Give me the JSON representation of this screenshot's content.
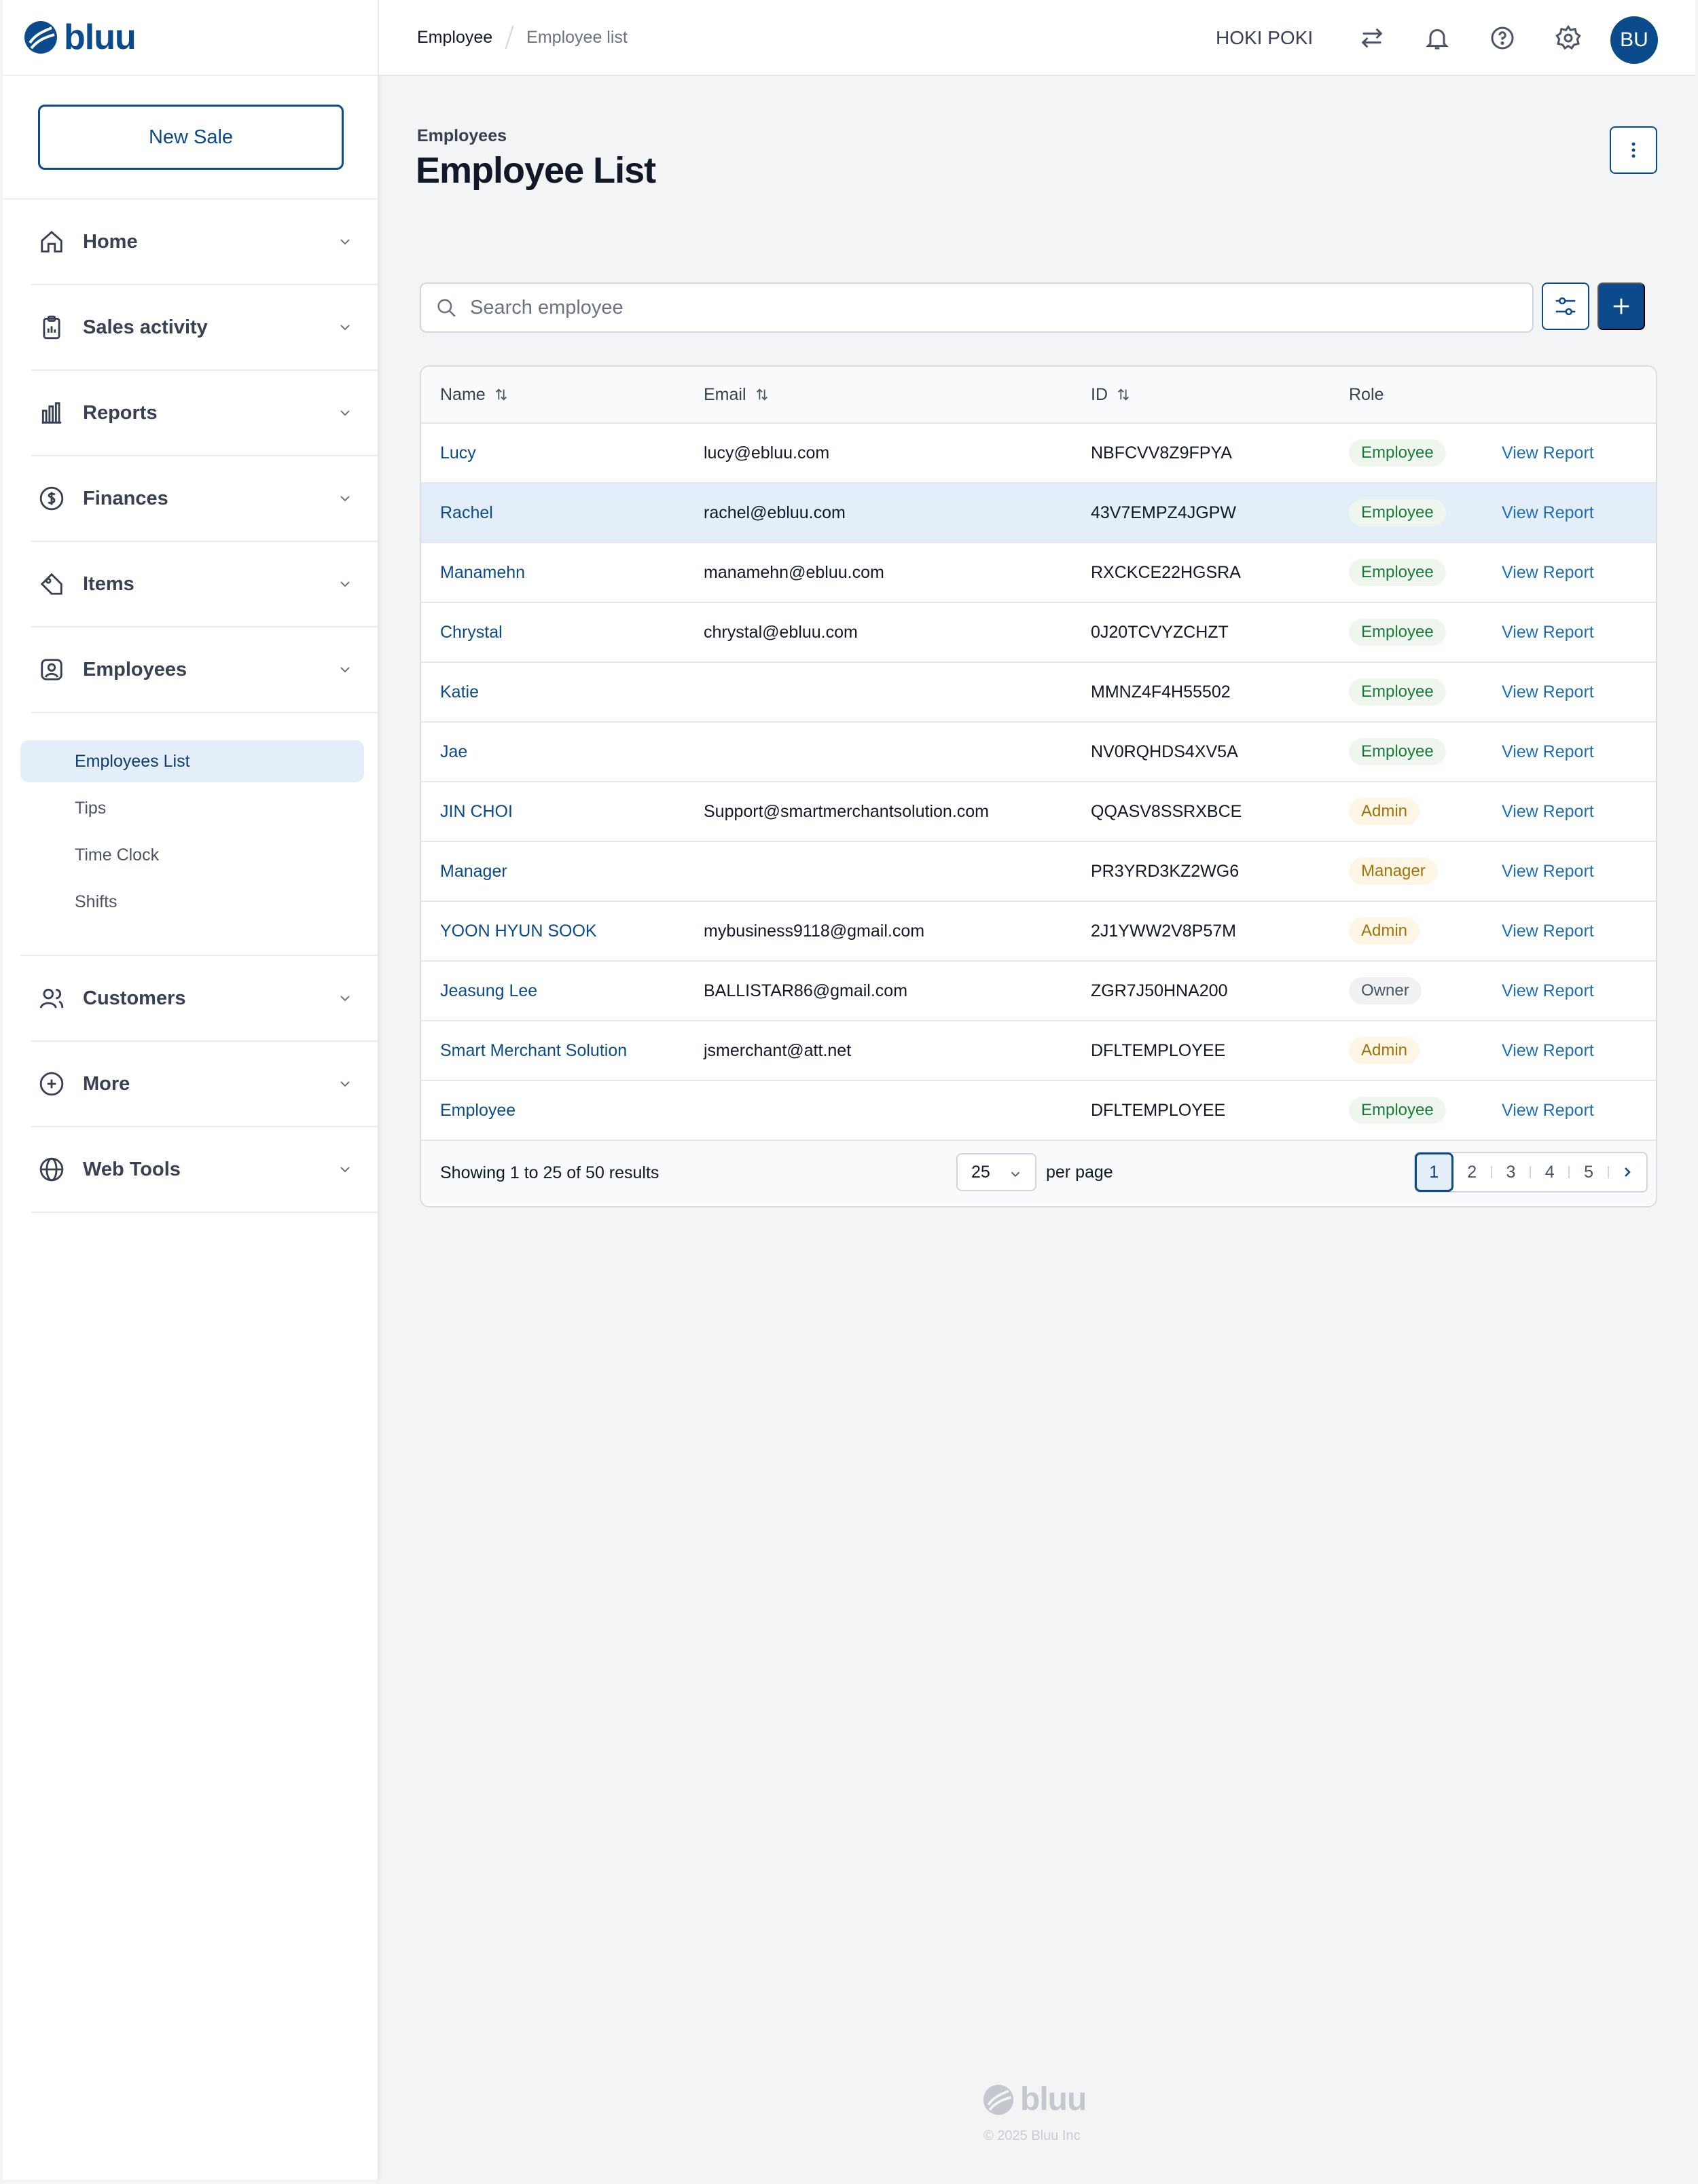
{
  "app": {
    "logo_text": "bluu"
  },
  "sidebar": {
    "new_sale_label": "New Sale",
    "items": [
      {
        "label": "Home",
        "icon": "home-icon"
      },
      {
        "label": "Sales activity",
        "icon": "clipboard-icon"
      },
      {
        "label": "Reports",
        "icon": "bar-chart-icon"
      },
      {
        "label": "Finances",
        "icon": "dollar-icon"
      },
      {
        "label": "Items",
        "icon": "tag-icon"
      },
      {
        "label": "Employees",
        "icon": "user-badge-icon"
      },
      {
        "label": "Customers",
        "icon": "users-icon"
      },
      {
        "label": "More",
        "icon": "plus-square-icon"
      },
      {
        "label": "Web Tools",
        "icon": "globe-icon"
      }
    ],
    "sub_items": [
      {
        "label": "Employees List",
        "active": true
      },
      {
        "label": "Tips"
      },
      {
        "label": "Time Clock"
      },
      {
        "label": "Shifts"
      }
    ]
  },
  "header": {
    "breadcrumb": [
      "Employee",
      "Employee list"
    ],
    "store_name": "HOKI POKI",
    "avatar_initials": "BU",
    "icons": [
      "transfer-icon",
      "bell-icon",
      "help-icon",
      "settings-icon"
    ]
  },
  "main": {
    "subtitle": "Employees",
    "title": "Employee List",
    "search": {
      "placeholder": "Search employee",
      "value": ""
    },
    "table": {
      "columns": [
        "Name",
        "Email",
        "ID",
        "Role"
      ],
      "action_label": "View Report",
      "rows": [
        {
          "name": "Lucy",
          "email": "lucy@ebluu.com",
          "id": "NBFCVV8Z9FPYA",
          "role": "Employee"
        },
        {
          "name": "Rachel",
          "email": "rachel@ebluu.com",
          "id": "43V7EMPZ4JGPW",
          "role": "Employee",
          "highlighted": true
        },
        {
          "name": "Manamehn",
          "email": "manamehn@ebluu.com",
          "id": "RXCKCE22HGSRA",
          "role": "Employee"
        },
        {
          "name": "Chrystal",
          "email": "chrystal@ebluu.com",
          "id": "0J20TCVYZCHZT",
          "role": "Employee"
        },
        {
          "name": "Katie",
          "email": "",
          "id": "MMNZ4F4H55502",
          "role": "Employee"
        },
        {
          "name": "Jae",
          "email": "",
          "id": "NV0RQHDS4XV5A",
          "role": "Employee"
        },
        {
          "name": "JIN CHOI",
          "email": "Support@smartmerchantsolution.com",
          "id": "QQASV8SSRXBCE",
          "role": "Admin"
        },
        {
          "name": "Manager",
          "email": "",
          "id": "PR3YRD3KZ2WG6",
          "role": "Manager"
        },
        {
          "name": "YOON HYUN SOOK",
          "email": "mybusiness9118@gmail.com",
          "id": "2J1YWW2V8P57M",
          "role": "Admin"
        },
        {
          "name": "Jeasung Lee",
          "email": "BALLISTAR86@gmail.com",
          "id": "ZGR7J50HNA200",
          "role": "Owner"
        },
        {
          "name": "Smart Merchant Solution",
          "email": "jsmerchant@att.net",
          "id": "DFLTEMPLOYEE",
          "role": "Admin"
        },
        {
          "name": "Employee",
          "email": "",
          "id": "DFLTEMPLOYEE",
          "role": "Employee"
        }
      ]
    },
    "pagination": {
      "showing_text": "Showing 1 to 25 of 50 results",
      "per_page_value": "25",
      "per_page_label": "per page",
      "pages": [
        "1",
        "2",
        "3",
        "4",
        "5"
      ],
      "current_page": "1"
    }
  },
  "footer": {
    "logo_text": "bluu",
    "copyright": "© 2025 Bluu Inc"
  },
  "colors": {
    "brand": "#0b4a8b",
    "link": "#1d6fb8",
    "highlight": "#e3eef8"
  }
}
